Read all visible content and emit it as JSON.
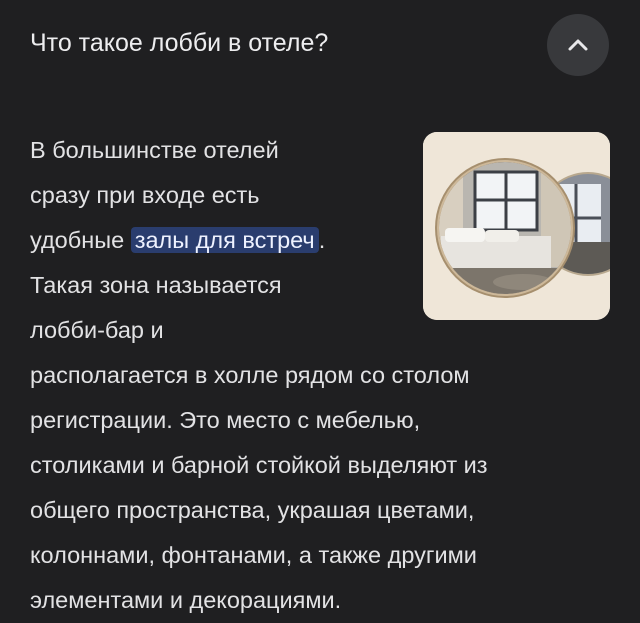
{
  "question": "Что такое лобби в отеле?",
  "collapse_icon": "chevron-up-icon",
  "answer": {
    "line1": "В большинстве отелей",
    "line2": "сразу при входе есть",
    "line3_before": "удобные ",
    "line3_link": "залы для встреч",
    "line3_after": ".",
    "line4": "Такая зона называется",
    "line5": "лобби-бар и",
    "line6": "располагается в холле рядом со столом",
    "line7": "регистрации. Это место с мебелью,",
    "line8": "столиками и барной стойкой выделяют из",
    "line9": "общего пространства, украшая цветами,",
    "line10": "колоннами, фонтанами, а также другими",
    "line11": "элементами и декорациями."
  },
  "colors": {
    "background": "#1f1f21",
    "highlight": "#2a3d6e",
    "button": "#38393c"
  }
}
